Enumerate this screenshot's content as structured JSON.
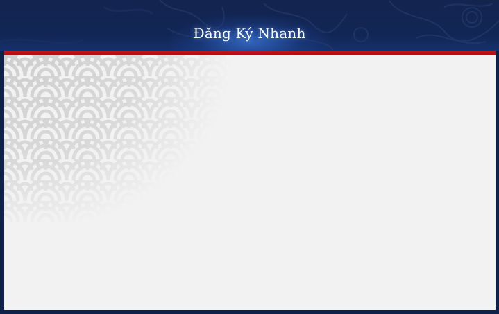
{
  "dialog": {
    "title": "Đăng Ký Nhanh"
  },
  "colors": {
    "frame": "#0f2149",
    "header_glow": "#3c78dc",
    "accent_red": "#d0121f",
    "panel": "#f2f2f2",
    "pattern": "#c8c8c8"
  }
}
